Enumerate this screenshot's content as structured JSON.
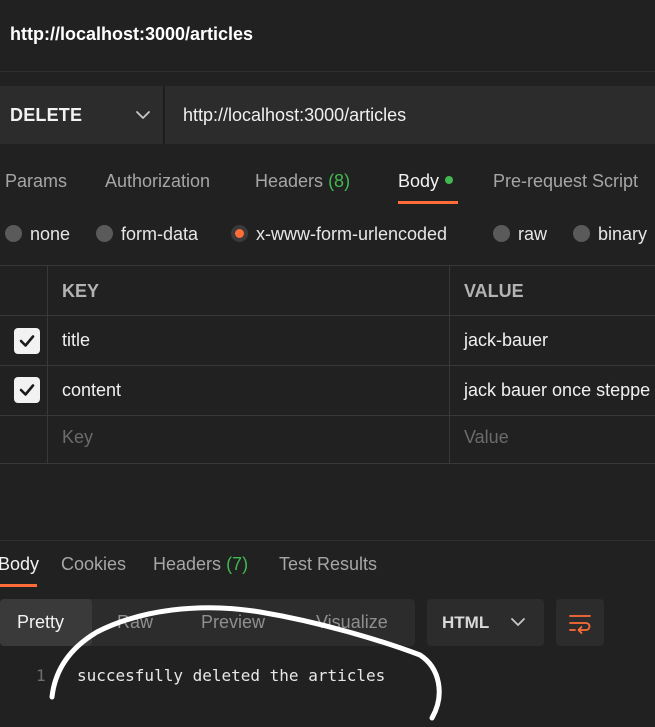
{
  "window": {
    "title": "http://localhost:3000/articles"
  },
  "request": {
    "method": "DELETE",
    "url": "http://localhost:3000/articles"
  },
  "request_tabs": {
    "params": "Params",
    "authorization": "Authorization",
    "headers": "Headers",
    "headers_count": "(8)",
    "body": "Body",
    "prerequest": "Pre-request Script"
  },
  "body_types": {
    "none": "none",
    "form_data": "form-data",
    "urlencoded": "x-www-form-urlencoded",
    "raw": "raw",
    "binary": "binary",
    "selected": "x-www-form-urlencoded"
  },
  "params_table": {
    "headers": {
      "key": "KEY",
      "value": "VALUE"
    },
    "rows": [
      {
        "checked": true,
        "key": "title",
        "value": "jack-bauer"
      },
      {
        "checked": true,
        "key": "content",
        "value": "jack bauer once steppe"
      }
    ],
    "placeholder": {
      "key": "Key",
      "value": "Value"
    }
  },
  "response_tabs": {
    "body": "Body",
    "cookies": "Cookies",
    "headers": "Headers",
    "headers_count": "(7)",
    "test_results": "Test Results"
  },
  "view_modes": {
    "pretty": "Pretty",
    "raw": "Raw",
    "preview": "Preview",
    "visualize": "Visualize",
    "selected": "Pretty"
  },
  "format": {
    "selected": "HTML"
  },
  "response": {
    "line_number": "1",
    "text": "succesfully deleted the articles"
  },
  "colors": {
    "accent": "#ff6c37",
    "count_green": "#3fb950",
    "background": "#212121",
    "input_bg": "#2c2c2c"
  }
}
